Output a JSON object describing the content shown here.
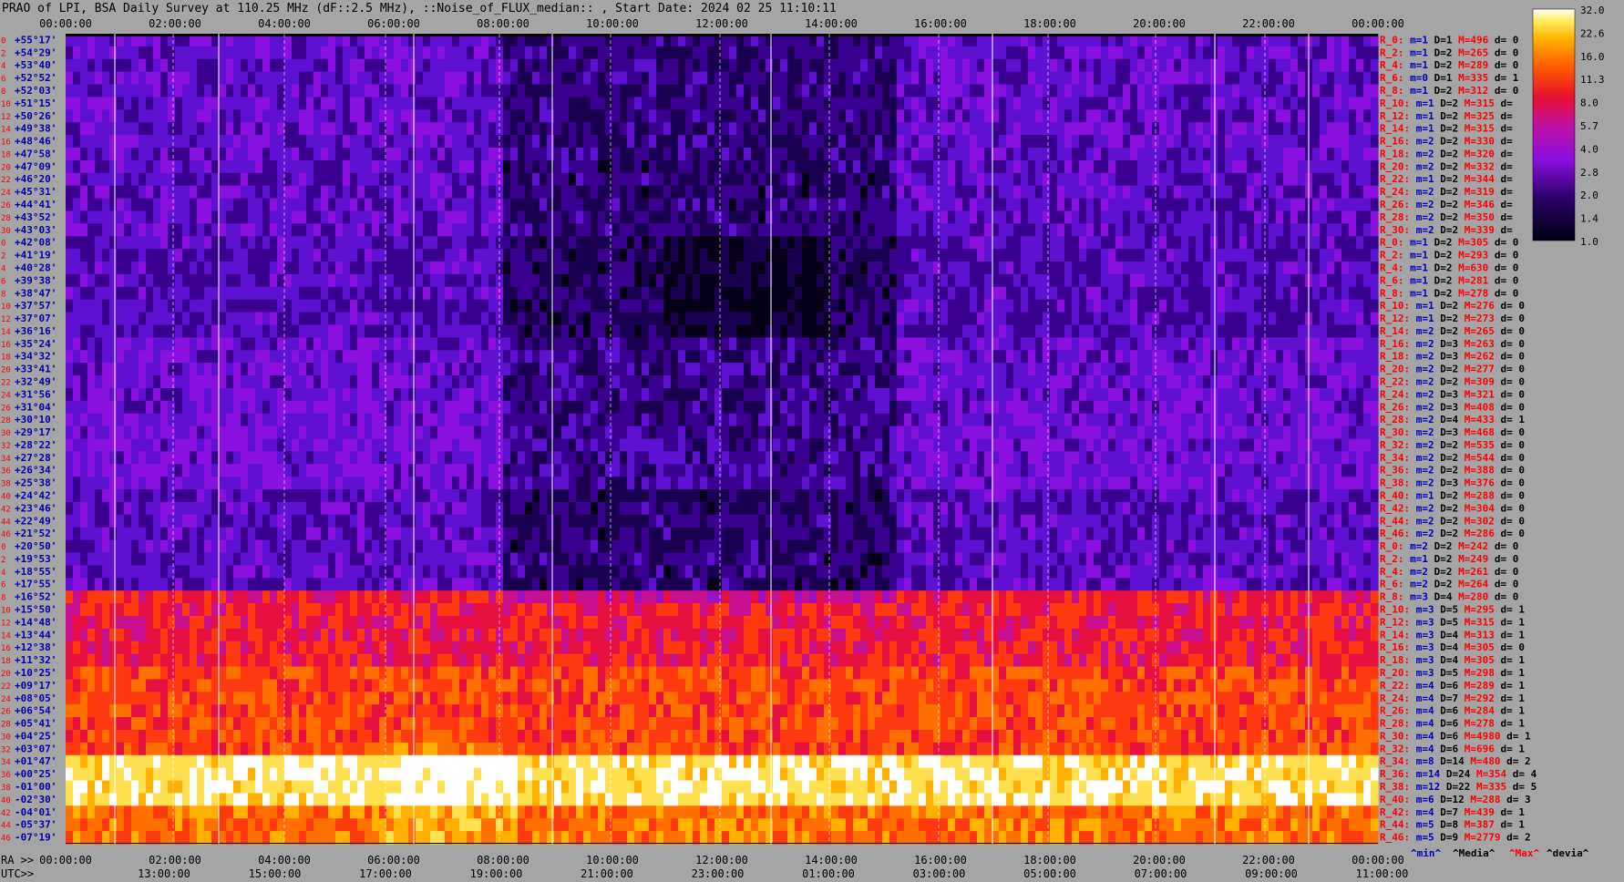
{
  "title": "PRAO of LPI, BSA Daily Survey at 110.25 MHz (dF::2.5 MHz), ::Noise_of_FLUX_median:: , Start Date: 2024 02 25 11:10:11",
  "chart_data": {
    "type": "heatmap",
    "top_time_ticks": [
      "00:00:00",
      "02:00:00",
      "04:00:00",
      "06:00:00",
      "08:00:00",
      "10:00:00",
      "12:00:00",
      "14:00:00",
      "16:00:00",
      "18:00:00",
      "20:00:00",
      "22:00:00",
      "00:00:00"
    ],
    "ra_ticks": [
      "00:00:00",
      "02:00:00",
      "04:00:00",
      "06:00:00",
      "08:00:00",
      "10:00:00",
      "12:00:00",
      "14:00:00",
      "16:00:00",
      "18:00:00",
      "20:00:00",
      "22:00:00",
      "00:00:00"
    ],
    "utc_ticks": [
      "13:00:00",
      "15:00:00",
      "17:00:00",
      "19:00:00",
      "21:00:00",
      "23:00:00",
      "01:00:00",
      "03:00:00",
      "05:00:00",
      "07:00:00",
      "09:00:00",
      "11:00:00"
    ],
    "ra_label": "RA >>",
    "utc_label": "UTC>>",
    "declinations": [
      "+55°17'",
      "+54°29'",
      "+53°40'",
      "+52°52'",
      "+52°03'",
      "+51°15'",
      "+50°26'",
      "+49°38'",
      "+48°46'",
      "+47°58'",
      "+47°09'",
      "+46°20'",
      "+45°31'",
      "+44°41'",
      "+43°52'",
      "+43°03'",
      "+42°08'",
      "+41°19'",
      "+40°28'",
      "+39°38'",
      "+38°47'",
      "+37°57'",
      "+37°07'",
      "+36°16'",
      "+35°24'",
      "+34°32'",
      "+33°41'",
      "+32°49'",
      "+31°56'",
      "+31°04'",
      "+30°10'",
      "+29°17'",
      "+28°22'",
      "+27°28'",
      "+26°34'",
      "+25°38'",
      "+24°42'",
      "+23°46'",
      "+22°49'",
      "+21°52'",
      "+20°50'",
      "+19°53'",
      "+18°55'",
      "+17°55'",
      "+16°52'",
      "+15°50'",
      "+14°48'",
      "+13°44'",
      "+12°38'",
      "+11°32'",
      "+10°25'",
      "+09°17'",
      "+08°05'",
      "+06°54'",
      "+05°41'",
      "+04°25'",
      "+03°07'",
      "+01°47'",
      "+00°25'",
      "-01°00'",
      "-02°30'",
      "-04°01'",
      "-05°37'",
      "-07°19'"
    ],
    "row_indices": [
      "0",
      "2",
      "4",
      "6",
      "8",
      "10",
      "12",
      "14",
      "16",
      "18",
      "20",
      "22",
      "24",
      "26",
      "28",
      "30",
      "0",
      "2",
      "4",
      "6",
      "8",
      "10",
      "12",
      "14",
      "16",
      "18",
      "20",
      "22",
      "24",
      "26",
      "28",
      "30",
      "32",
      "34",
      "36",
      "38",
      "40",
      "42",
      "44",
      "46",
      "0",
      "2",
      "4",
      "6",
      "8",
      "10",
      "12",
      "14",
      "16",
      "18",
      "20",
      "22",
      "24",
      "26",
      "28",
      "30",
      "32",
      "34",
      "36",
      "38",
      "40",
      "42",
      "44",
      "46"
    ],
    "receivers": [
      {
        "r": "R_0:",
        "m": "m=1",
        "D": "D=1",
        "M": "M=496",
        "d": "d= 0"
      },
      {
        "r": "R_2:",
        "m": "m=1",
        "D": "D=2",
        "M": "M=265",
        "d": "d= 0"
      },
      {
        "r": "R_4:",
        "m": "m=1",
        "D": "D=2",
        "M": "M=289",
        "d": "d= 0"
      },
      {
        "r": "R_6:",
        "m": "m=0",
        "D": "D=1",
        "M": "M=335",
        "d": "d= 1"
      },
      {
        "r": "R_8:",
        "m": "m=1",
        "D": "D=2",
        "M": "M=312",
        "d": "d= 0"
      },
      {
        "r": "R_10:",
        "m": "m=1",
        "D": "D=2",
        "M": "M=315",
        "d": "d="
      },
      {
        "r": "R_12:",
        "m": "m=1",
        "D": "D=2",
        "M": "M=325",
        "d": "d="
      },
      {
        "r": "R_14:",
        "m": "m=1",
        "D": "D=2",
        "M": "M=315",
        "d": "d="
      },
      {
        "r": "R_16:",
        "m": "m=2",
        "D": "D=2",
        "M": "M=330",
        "d": "d="
      },
      {
        "r": "R_18:",
        "m": "m=2",
        "D": "D=2",
        "M": "M=320",
        "d": "d="
      },
      {
        "r": "R_20:",
        "m": "m=2",
        "D": "D=2",
        "M": "M=332",
        "d": "d="
      },
      {
        "r": "R_22:",
        "m": "m=1",
        "D": "D=2",
        "M": "M=344",
        "d": "d="
      },
      {
        "r": "R_24:",
        "m": "m=2",
        "D": "D=2",
        "M": "M=319",
        "d": "d="
      },
      {
        "r": "R_26:",
        "m": "m=2",
        "D": "D=2",
        "M": "M=346",
        "d": "d="
      },
      {
        "r": "R_28:",
        "m": "m=2",
        "D": "D=2",
        "M": "M=350",
        "d": "d="
      },
      {
        "r": "R_30:",
        "m": "m=2",
        "D": "D=2",
        "M": "M=339",
        "d": "d="
      },
      {
        "r": "R_0:",
        "m": "m=1",
        "D": "D=2",
        "M": "M=305",
        "d": "d= 0"
      },
      {
        "r": "R_2:",
        "m": "m=1",
        "D": "D=2",
        "M": "M=293",
        "d": "d= 0"
      },
      {
        "r": "R_4:",
        "m": "m=1",
        "D": "D=2",
        "M": "M=630",
        "d": "d= 0"
      },
      {
        "r": "R_6:",
        "m": "m=1",
        "D": "D=2",
        "M": "M=281",
        "d": "d= 0"
      },
      {
        "r": "R_8:",
        "m": "m=1",
        "D": "D=2",
        "M": "M=278",
        "d": "d= 0"
      },
      {
        "r": "R_10:",
        "m": "m=1",
        "D": "D=2",
        "M": "M=276",
        "d": "d= 0"
      },
      {
        "r": "R_12:",
        "m": "m=1",
        "D": "D=2",
        "M": "M=273",
        "d": "d= 0"
      },
      {
        "r": "R_14:",
        "m": "m=2",
        "D": "D=2",
        "M": "M=265",
        "d": "d= 0"
      },
      {
        "r": "R_16:",
        "m": "m=2",
        "D": "D=3",
        "M": "M=263",
        "d": "d= 0"
      },
      {
        "r": "R_18:",
        "m": "m=2",
        "D": "D=3",
        "M": "M=262",
        "d": "d= 0"
      },
      {
        "r": "R_20:",
        "m": "m=2",
        "D": "D=2",
        "M": "M=277",
        "d": "d= 0"
      },
      {
        "r": "R_22:",
        "m": "m=2",
        "D": "D=2",
        "M": "M=309",
        "d": "d= 0"
      },
      {
        "r": "R_24:",
        "m": "m=2",
        "D": "D=3",
        "M": "M=321",
        "d": "d= 0"
      },
      {
        "r": "R_26:",
        "m": "m=2",
        "D": "D=3",
        "M": "M=408",
        "d": "d= 0"
      },
      {
        "r": "R_28:",
        "m": "m=2",
        "D": "D=4",
        "M": "M=433",
        "d": "d= 1"
      },
      {
        "r": "R_30:",
        "m": "m=2",
        "D": "D=3",
        "M": "M=468",
        "d": "d= 0"
      },
      {
        "r": "R_32:",
        "m": "m=2",
        "D": "D=2",
        "M": "M=535",
        "d": "d= 0"
      },
      {
        "r": "R_34:",
        "m": "m=2",
        "D": "D=2",
        "M": "M=544",
        "d": "d= 0"
      },
      {
        "r": "R_36:",
        "m": "m=2",
        "D": "D=2",
        "M": "M=388",
        "d": "d= 0"
      },
      {
        "r": "R_38:",
        "m": "m=2",
        "D": "D=3",
        "M": "M=376",
        "d": "d= 0"
      },
      {
        "r": "R_40:",
        "m": "m=1",
        "D": "D=2",
        "M": "M=288",
        "d": "d= 0"
      },
      {
        "r": "R_42:",
        "m": "m=2",
        "D": "D=2",
        "M": "M=304",
        "d": "d= 0"
      },
      {
        "r": "R_44:",
        "m": "m=2",
        "D": "D=2",
        "M": "M=302",
        "d": "d= 0"
      },
      {
        "r": "R_46:",
        "m": "m=2",
        "D": "D=2",
        "M": "M=286",
        "d": "d= 0"
      },
      {
        "r": "R_0:",
        "m": "m=2",
        "D": "D=2",
        "M": "M=242",
        "d": "d= 0"
      },
      {
        "r": "R_2:",
        "m": "m=1",
        "D": "D=2",
        "M": "M=249",
        "d": "d= 0"
      },
      {
        "r": "R_4:",
        "m": "m=2",
        "D": "D=2",
        "M": "M=261",
        "d": "d= 0"
      },
      {
        "r": "R_6:",
        "m": "m=2",
        "D": "D=2",
        "M": "M=264",
        "d": "d= 0"
      },
      {
        "r": "R_8:",
        "m": "m=3",
        "D": "D=4",
        "M": "M=280",
        "d": "d= 0"
      },
      {
        "r": "R_10:",
        "m": "m=3",
        "D": "D=5",
        "M": "M=295",
        "d": "d= 1"
      },
      {
        "r": "R_12:",
        "m": "m=3",
        "D": "D=5",
        "M": "M=315",
        "d": "d= 1"
      },
      {
        "r": "R_14:",
        "m": "m=3",
        "D": "D=4",
        "M": "M=313",
        "d": "d= 1"
      },
      {
        "r": "R_16:",
        "m": "m=3",
        "D": "D=4",
        "M": "M=305",
        "d": "d= 0"
      },
      {
        "r": "R_18:",
        "m": "m=3",
        "D": "D=4",
        "M": "M=305",
        "d": "d= 1"
      },
      {
        "r": "R_20:",
        "m": "m=3",
        "D": "D=5",
        "M": "M=298",
        "d": "d= 1"
      },
      {
        "r": "R_22:",
        "m": "m=4",
        "D": "D=6",
        "M": "M=289",
        "d": "d= 1"
      },
      {
        "r": "R_24:",
        "m": "m=4",
        "D": "D=7",
        "M": "M=292",
        "d": "d= 1"
      },
      {
        "r": "R_26:",
        "m": "m=4",
        "D": "D=6",
        "M": "M=284",
        "d": "d= 1"
      },
      {
        "r": "R_28:",
        "m": "m=4",
        "D": "D=6",
        "M": "M=278",
        "d": "d= 1"
      },
      {
        "r": "R_30:",
        "m": "m=4",
        "D": "D=6",
        "M": "M=4980",
        "d": "d= 1"
      },
      {
        "r": "R_32:",
        "m": "m=4",
        "D": "D=6",
        "M": "M=696",
        "d": "d= 1"
      },
      {
        "r": "R_34:",
        "m": "m=8",
        "D": "D=14",
        "M": "M=480",
        "d": "d= 2"
      },
      {
        "r": "R_36:",
        "m": "m=14",
        "D": "D=24",
        "M": "M=354",
        "d": "d= 4"
      },
      {
        "r": "R_38:",
        "m": "m=12",
        "D": "D=22",
        "M": "M=335",
        "d": "d= 5"
      },
      {
        "r": "R_40:",
        "m": "m=6",
        "D": "D=12",
        "M": "M=288",
        "d": "d= 3"
      },
      {
        "r": "R_42:",
        "m": "m=4",
        "D": "D=7",
        "M": "M=439",
        "d": "d= 1"
      },
      {
        "r": "R_44:",
        "m": "m=5",
        "D": "D=8",
        "M": "M=387",
        "d": "d= 1"
      },
      {
        "r": "R_46:",
        "m": "m=5",
        "D": "D=9",
        "M": "M=2779",
        "d": "d= 2"
      }
    ],
    "footer_legend": {
      "min": "^min^",
      "media": "^Media^",
      "max": "^Max^",
      "devia": "^devia^"
    },
    "colorbar_ticks": [
      "32.0",
      "22.6",
      "16.0",
      "11.3",
      "8.0",
      "5.7",
      "4.0",
      "2.8",
      "2.0",
      "1.4",
      "1.0"
    ],
    "colors": {
      "background": "#a5a5a5",
      "row_index": "#ff0000",
      "dec_label": "#0000aa",
      "recv_name": "#ff0000",
      "recv_m": "#0000bb",
      "recv_D": "#000000",
      "recv_M": "#ff0000",
      "recv_d": "#000000"
    }
  }
}
